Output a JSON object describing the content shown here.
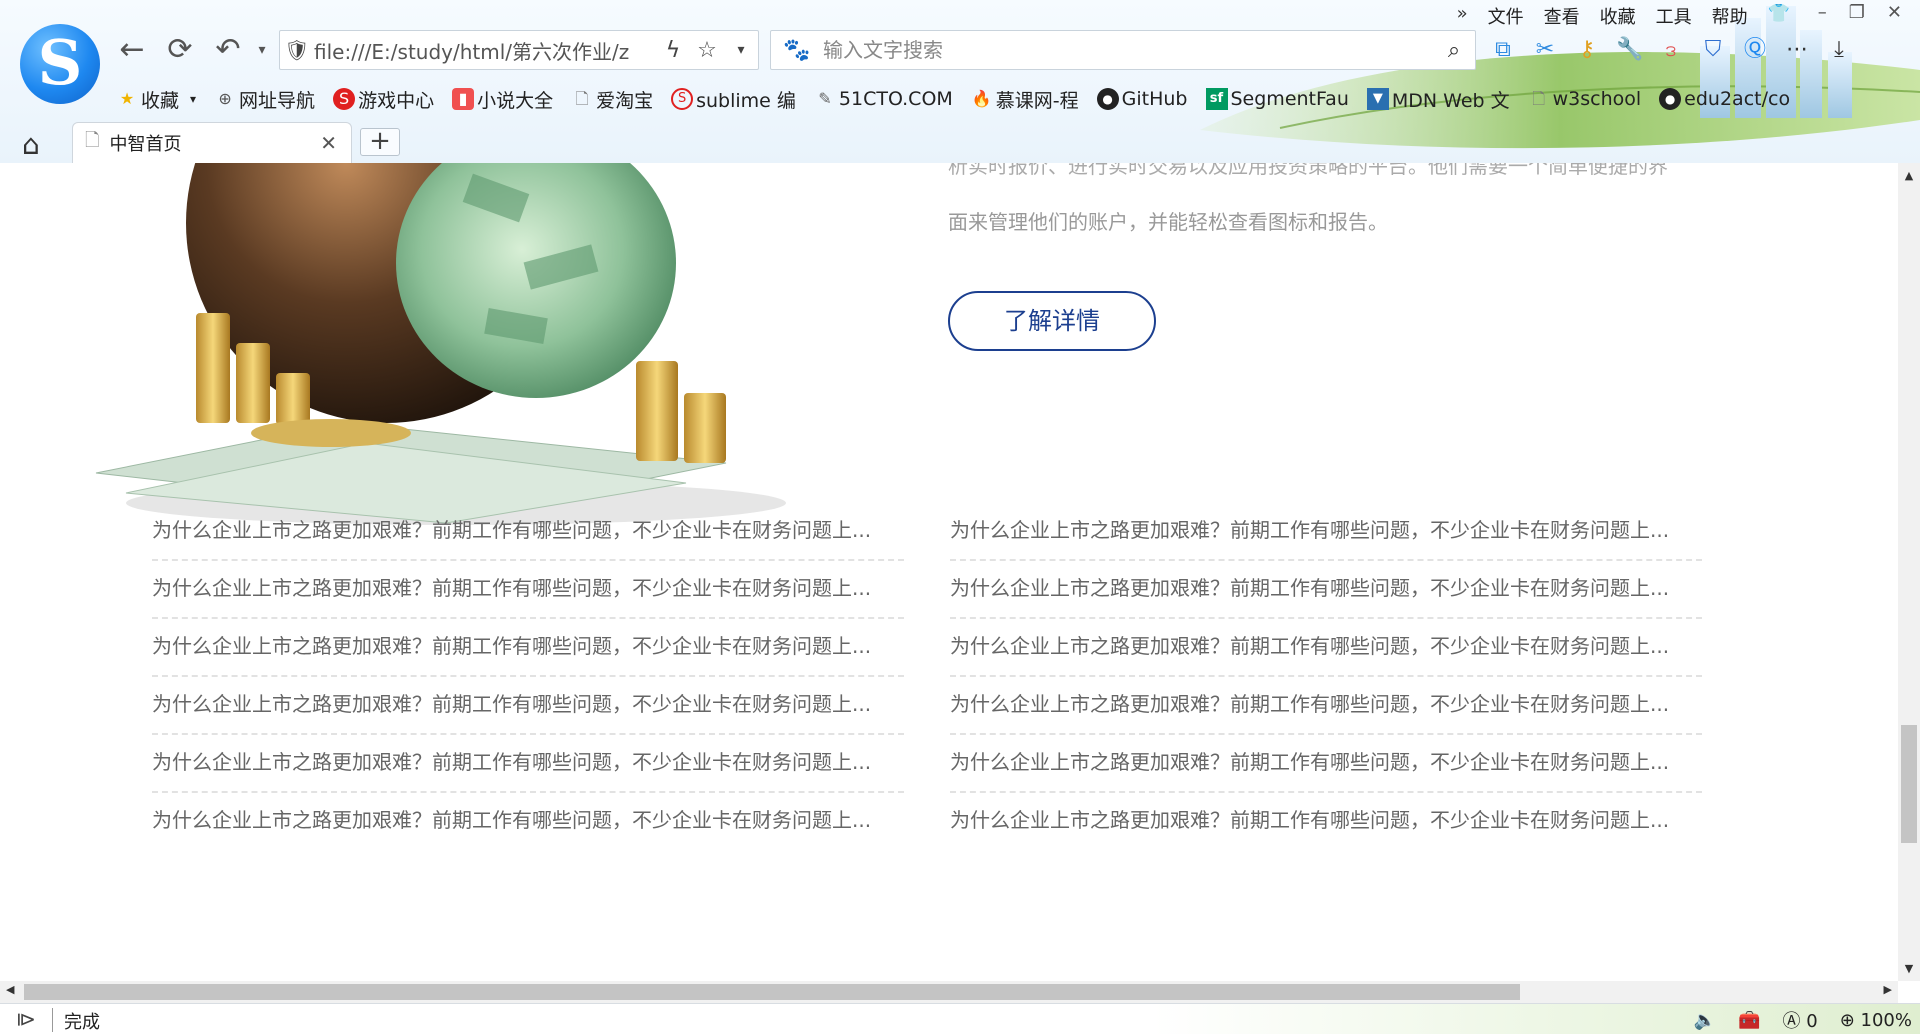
{
  "menu": {
    "overflow": "»",
    "items": [
      "文件",
      "查看",
      "收藏",
      "工具",
      "帮助"
    ]
  },
  "address_bar": {
    "url": "file:///E:/study/html/第六次作业/z"
  },
  "search_bar": {
    "placeholder": "输入文字搜索"
  },
  "bookmarks": [
    {
      "label": "收藏",
      "icon": "star-icon"
    },
    {
      "label": "网址导航",
      "icon": "globe-icon"
    },
    {
      "label": "游戏中心",
      "icon": "sogou-game-icon"
    },
    {
      "label": "小说大全",
      "icon": "novel-icon"
    },
    {
      "label": "爱淘宝",
      "icon": "page-icon"
    },
    {
      "label": "sublime 编",
      "icon": "sogou-icon"
    },
    {
      "label": "51CTO.COM",
      "icon": "pen-icon"
    },
    {
      "label": "慕课网-程",
      "icon": "flame-icon"
    },
    {
      "label": "GitHub",
      "icon": "github-icon"
    },
    {
      "label": "SegmentFau",
      "icon": "sf-icon"
    },
    {
      "label": "MDN Web 文",
      "icon": "mdn-icon"
    },
    {
      "label": "w3school",
      "icon": "page-icon"
    },
    {
      "label": "edu2act/co",
      "icon": "github-icon"
    }
  ],
  "tab": {
    "title": "中智首页",
    "new_tab": "+"
  },
  "page": {
    "intro_line1": "析实时报价、进行实时交易以及应用投资策略的平台。他们需要一个简单便捷的界",
    "intro_line2": "面来管理他们的账户，并能轻松查看图标和报告。",
    "learn_more": "了解详情",
    "news_left": [
      "为什么企业上市之路更加艰难？前期工作有哪些问题，不少企业卡在财务问题上...",
      "为什么企业上市之路更加艰难？前期工作有哪些问题，不少企业卡在财务问题上...",
      "为什么企业上市之路更加艰难？前期工作有哪些问题，不少企业卡在财务问题上...",
      "为什么企业上市之路更加艰难？前期工作有哪些问题，不少企业卡在财务问题上...",
      "为什么企业上市之路更加艰难？前期工作有哪些问题，不少企业卡在财务问题上...",
      "为什么企业上市之路更加艰难？前期工作有哪些问题，不少企业卡在财务问题上..."
    ],
    "news_right": [
      "为什么企业上市之路更加艰难？前期工作有哪些问题，不少企业卡在财务问题上...",
      "为什么企业上市之路更加艰难？前期工作有哪些问题，不少企业卡在财务问题上...",
      "为什么企业上市之路更加艰难？前期工作有哪些问题，不少企业卡在财务问题上...",
      "为什么企业上市之路更加艰难？前期工作有哪些问题，不少企业卡在财务问题上...",
      "为什么企业上市之路更加艰难？前期工作有哪些问题，不少企业卡在财务问题上...",
      "为什么企业上市之路更加艰难？前期工作有哪些问题，不少企业卡在财务问题上..."
    ]
  },
  "status_bar": {
    "text": "完成",
    "badge_count": "0",
    "zoom": "100%"
  },
  "colors": {
    "accent_blue": "#1c3f8f",
    "logo_blue": "#1e88f0"
  }
}
